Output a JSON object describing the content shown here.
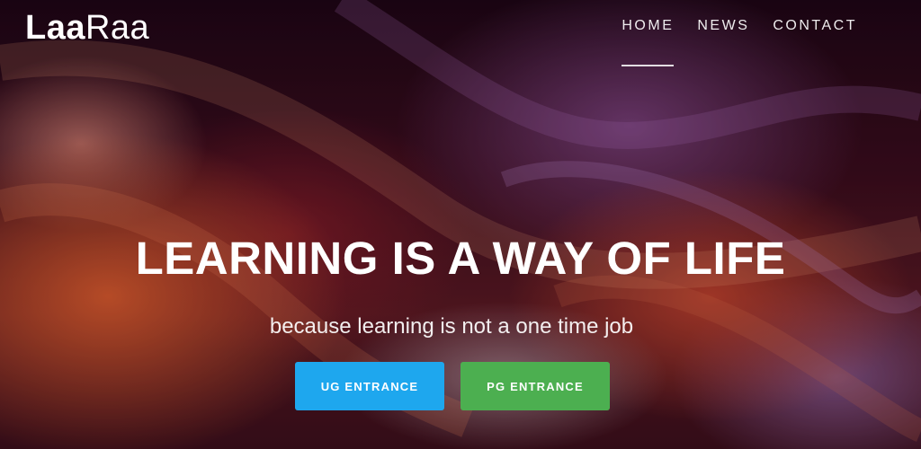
{
  "brand": {
    "logo_bold": "Laa",
    "logo_light": "Raa"
  },
  "nav": {
    "items": [
      {
        "label": "HOME",
        "active": true
      },
      {
        "label": "NEWS",
        "active": false
      },
      {
        "label": "CONTACT",
        "active": false
      }
    ]
  },
  "hero": {
    "headline": "LEARNING IS A WAY OF LIFE",
    "subheadline": "because learning is not a one time job",
    "background": "canyon-photo",
    "buttons": {
      "ug_label": "UG ENTRANCE",
      "pg_label": "PG ENTRANCE"
    }
  },
  "colors": {
    "ug_button": "#1ea7ee",
    "pg_button": "#4caf50"
  }
}
